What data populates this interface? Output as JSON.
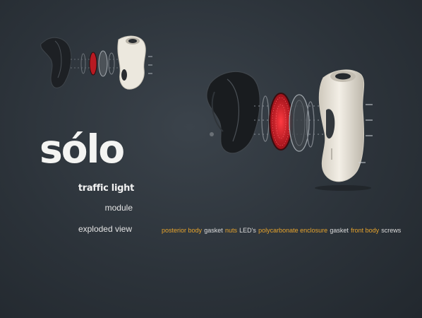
{
  "brand": {
    "name": "sólo",
    "subtitle": "traffic light"
  },
  "labels": {
    "module": "module",
    "exploded_view": "exploded view"
  },
  "parts": [
    {
      "label": "posterior body",
      "highlight": true
    },
    {
      "label": "gasket",
      "highlight": false
    },
    {
      "label": "nuts",
      "highlight": true
    },
    {
      "label": "LED's",
      "highlight": false
    },
    {
      "label": "polycarbonate enclosure",
      "highlight": true
    },
    {
      "label": "gasket",
      "highlight": false
    },
    {
      "label": "front body",
      "highlight": true
    },
    {
      "label": "screws",
      "highlight": false
    }
  ],
  "colors": {
    "background": "#2c333a",
    "highlight_label": "#e8a42c",
    "plain_label": "#dcdcdc",
    "led": "#d8202a",
    "front_body": "#eae6dc",
    "posterior_body": "#1c1f22"
  }
}
